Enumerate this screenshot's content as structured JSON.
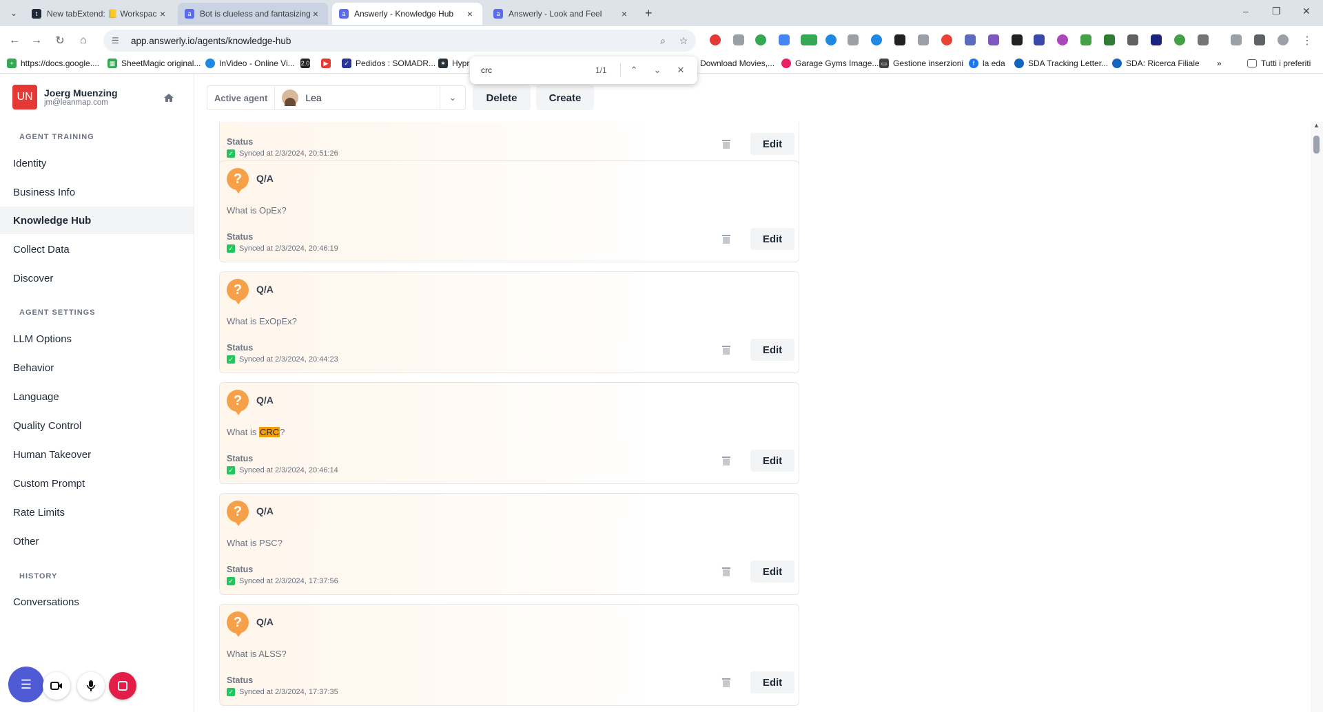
{
  "browser": {
    "tabs": [
      {
        "title": "New tabExtend: 📒 Workspace",
        "state": "normal"
      },
      {
        "title": "Bot is clueless and fantasizing",
        "state": "hover"
      },
      {
        "title": "Answerly - Knowledge Hub",
        "state": "active"
      },
      {
        "title": "Answerly - Look and Feel",
        "state": "normal"
      }
    ],
    "url": "app.answerly.io/agents/knowledge-hub",
    "bookmarks": [
      "https://docs.google....",
      "SheetMagic original...",
      "InVideo - Online Vi...",
      "Pedidos : SOMADR...",
      "Hypr",
      "Download Movies,...",
      "Garage Gyms Image...",
      "Gestione inserzioni",
      "la eda",
      "SDA Tracking Letter...",
      "SDA: Ricerca Filiale",
      "Tutti i preferiti"
    ],
    "find": {
      "query": "crc",
      "count": "1/1"
    }
  },
  "user": {
    "initials": "UN",
    "name": "Joerg Muenzing",
    "email": "jm@leanmap.com"
  },
  "sidebar": {
    "training_title": "AGENT TRAINING",
    "training_items": [
      "Identity",
      "Business Info",
      "Knowledge Hub",
      "Collect Data",
      "Discover"
    ],
    "settings_title": "AGENT SETTINGS",
    "settings_items": [
      "LLM Options",
      "Behavior",
      "Language",
      "Quality Control",
      "Human Takeover",
      "Custom Prompt",
      "Rate Limits",
      "Other"
    ],
    "history_title": "HISTORY",
    "history_items": [
      "Conversations"
    ]
  },
  "topbar": {
    "active_agent_label": "Active agent",
    "agent_name": "Lea",
    "delete_label": "Delete",
    "create_label": "Create"
  },
  "cards": [
    {
      "type": "Q/A",
      "question": "",
      "status_label": "Status",
      "synced": "Synced at 2/3/2024, 20:51:26",
      "edit_label": "Edit"
    },
    {
      "type": "Q/A",
      "question": "What is OpEx?",
      "status_label": "Status",
      "synced": "Synced at 2/3/2024, 20:46:19",
      "edit_label": "Edit"
    },
    {
      "type": "Q/A",
      "question": "What is ExOpEx?",
      "status_label": "Status",
      "synced": "Synced at 2/3/2024, 20:44:23",
      "edit_label": "Edit"
    },
    {
      "type": "Q/A",
      "question_pre": "What is ",
      "question_hl": "CRC",
      "question_post": "?",
      "status_label": "Status",
      "synced": "Synced at 2/3/2024, 20:46:14",
      "edit_label": "Edit"
    },
    {
      "type": "Q/A",
      "question": "What is PSC?",
      "status_label": "Status",
      "synced": "Synced at 2/3/2024, 17:37:56",
      "edit_label": "Edit"
    },
    {
      "type": "Q/A",
      "question": "What is ALSS?",
      "status_label": "Status",
      "synced": "Synced at 2/3/2024, 17:37:35",
      "edit_label": "Edit"
    }
  ],
  "colors": {
    "accent": "#f6a04a",
    "highlight": "#f59e0b",
    "synced": "#22c55e",
    "avatar": "#e53935"
  }
}
